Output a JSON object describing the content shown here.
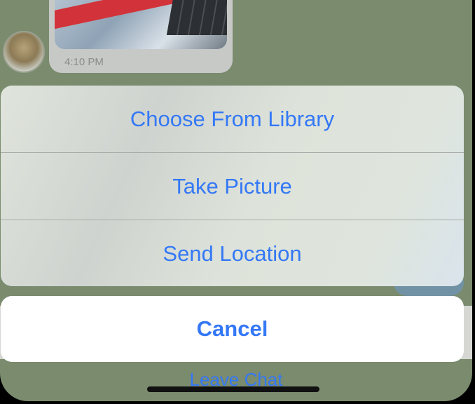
{
  "chat": {
    "message_time": "4:10 PM",
    "leave_chat_label": "Leave Chat"
  },
  "action_sheet": {
    "items": [
      {
        "label": "Choose From Library"
      },
      {
        "label": "Take Picture"
      },
      {
        "label": "Send Location"
      }
    ],
    "cancel_label": "Cancel"
  },
  "colors": {
    "accent": "#3478f6",
    "chat_background": "#7a8b6e",
    "sheet_background": "#dfe4dc",
    "cancel_background": "#ffffff"
  }
}
